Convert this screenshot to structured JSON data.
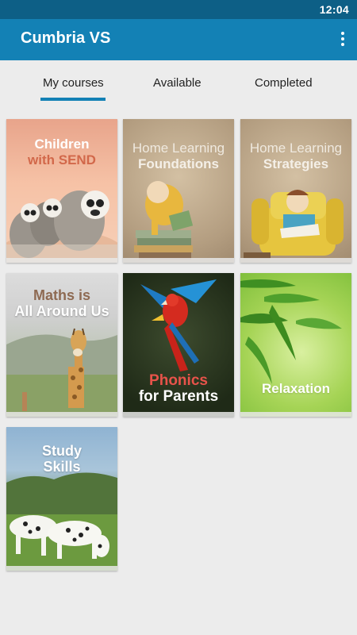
{
  "status_bar": {
    "time": "12:04"
  },
  "app_bar": {
    "title": "Cumbria VS",
    "menu_icon": "more-vert-icon"
  },
  "tabs": [
    {
      "label": "My courses",
      "selected": true
    },
    {
      "label": "Available",
      "selected": false
    },
    {
      "label": "Completed",
      "selected": false
    }
  ],
  "courses": [
    {
      "line1": "Children",
      "line2": "with SEND",
      "image": "lemurs"
    },
    {
      "line1": "Home Learning",
      "line2": "Foundations",
      "image": "girl-reading-books"
    },
    {
      "line1": "Home Learning",
      "line2": "Strategies",
      "image": "boy-in-armchair"
    },
    {
      "line1": "Maths is",
      "line2": "All Around Us",
      "image": "giraffe"
    },
    {
      "line1": "Phonics",
      "line2": "for Parents",
      "image": "parrot"
    },
    {
      "line1": "Relaxation",
      "image": "bamboo-leaves"
    },
    {
      "line1": "Study",
      "line2": "Skills",
      "image": "dalmatians"
    }
  ],
  "colors": {
    "status_bar": "#0d5f86",
    "app_bar": "#1381b5",
    "tab_indicator": "#1381b5",
    "background": "#ececec"
  }
}
